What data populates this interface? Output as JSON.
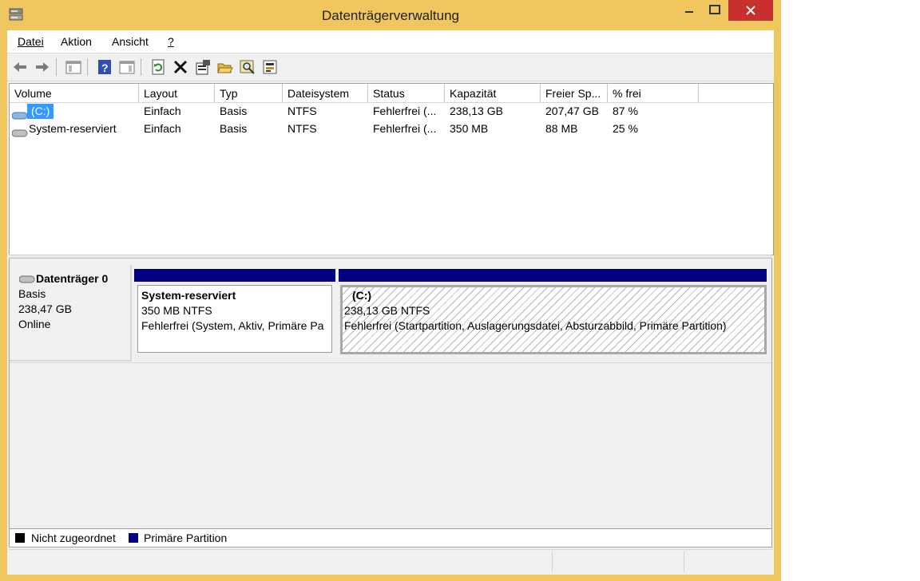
{
  "window": {
    "title": "Datenträgerverwaltung"
  },
  "menu": [
    {
      "label": "Datei"
    },
    {
      "label": "Aktion"
    },
    {
      "label": "Ansicht"
    },
    {
      "label": "?"
    }
  ],
  "toolbar": {
    "icons": [
      "back-arrow-icon",
      "forward-arrow-icon",
      "console-tree-icon",
      "help-icon",
      "action-pane-icon",
      "refresh-icon",
      "delete-icon",
      "properties-icon",
      "open-folder-icon",
      "search-icon",
      "rescan-disks-icon"
    ]
  },
  "volume_list": {
    "columns": [
      "Volume",
      "Layout",
      "Typ",
      "Dateisystem",
      "Status",
      "Kapazität",
      "Freier Sp...",
      "% frei"
    ],
    "rows": [
      [
        "(C:)",
        "Einfach",
        "Basis",
        "NTFS",
        "Fehlerfrei (...",
        "238,13 GB",
        "207,47 GB",
        "87 %"
      ],
      [
        "System-reserviert",
        "Einfach",
        "Basis",
        "NTFS",
        "Fehlerfrei (...",
        "350 MB",
        "88 MB",
        "25 %"
      ]
    ]
  },
  "disk": {
    "name": "Datenträger 0",
    "type": "Basis",
    "size": "238,47 GB",
    "state": "Online",
    "partitions": [
      {
        "title": "System-reserviert",
        "size": "350 MB NTFS",
        "status": "Fehlerfrei (System, Aktiv, Primäre Pa"
      },
      {
        "title": "(C:)",
        "size": "238,13 GB NTFS",
        "status": "Fehlerfrei (Startpartition, Auslagerungsdatei, Absturzabbild, Primäre Partition)"
      }
    ]
  },
  "legend": [
    {
      "label": "Nicht zugeordnet",
      "color": "#000000"
    },
    {
      "label": "Primäre Partition",
      "color": "#000080"
    }
  ],
  "colors": {
    "titlebar": "#f0c65e",
    "close": "#c7302c",
    "primary_partition": "#000080",
    "selection": "#3399ff"
  }
}
